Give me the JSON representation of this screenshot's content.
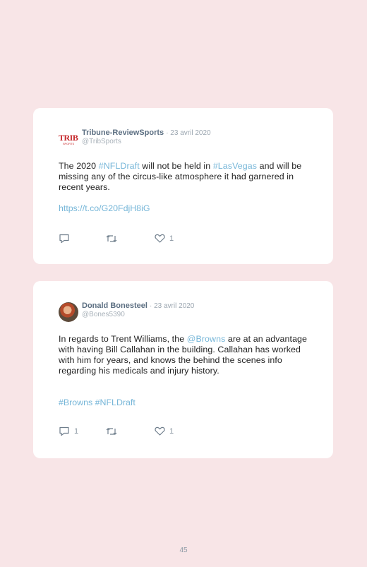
{
  "tweets": [
    {
      "name": "Tribune-ReviewSports",
      "date": "· 23 avril 2020",
      "handle": "@TribSports",
      "avatar_logo": "TRIB",
      "avatar_sub": "SPORTS",
      "text_parts": [
        "The 2020 ",
        "#NFLDraft",
        " will not be held in ",
        "#LasVegas",
        " and will be missing any of the circus-like atmosphere it had garnered in recent years."
      ],
      "extra": "https://t.co/G20FdjH8iG",
      "reply_count": "",
      "like_count": "1"
    },
    {
      "name": "Donald Bonesteel",
      "date": "· 23 avril 2020",
      "handle": "@Bones5390",
      "text_parts": [
        "In regards to Trent Williams, the ",
        "@Browns",
        " are at an advantage with having Bill Callahan in the building. Callahan has worked with him for years, and knows the behind the scenes info regarding his medicals and injury history."
      ],
      "extra": "#Browns #NFLDraft",
      "reply_count": "1",
      "like_count": "1"
    }
  ],
  "page_number": "45",
  "colors": {
    "background": "#f8e5e7",
    "link": "#76b6d8",
    "name": "#5c6f82"
  },
  "icons": [
    "reply-icon",
    "retweet-icon",
    "like-icon"
  ]
}
